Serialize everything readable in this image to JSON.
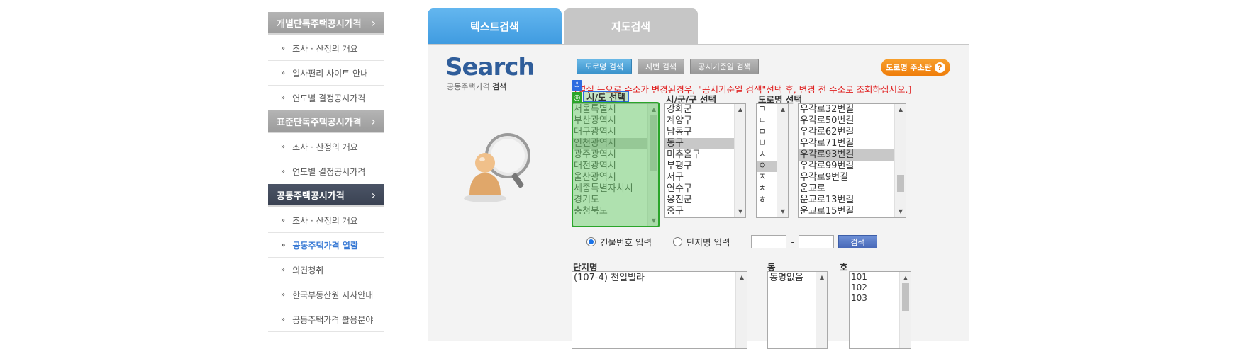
{
  "sidebar": {
    "sections": [
      {
        "title": "개별단독주택공시가격",
        "items": [
          "조사 · 산정의 개요",
          "일사편리 사이트 안내",
          "연도별 결정공시가격"
        ]
      },
      {
        "title": "표준단독주택공시가격",
        "items": [
          "조사 · 산정의 개요",
          "연도별 결정공시가격"
        ]
      },
      {
        "title": "공동주택공시가격",
        "items": [
          "조사 · 산정의 개요",
          "공동주택가격 열람",
          "의견청취",
          "한국부동산원 지사안내",
          "공동주택가격 활용분야"
        ]
      }
    ],
    "chevron": "›",
    "bullet": "»"
  },
  "tabs": {
    "text": "텍스트검색",
    "map": "지도검색"
  },
  "logo": {
    "big": "Search",
    "sub_prefix": "공동주택가격",
    "sub_bold": "검색"
  },
  "buttons": {
    "road": "도로명 검색",
    "lot": "지번 검색",
    "notice": "공시기준일 검색",
    "guide": "도로명 주소란",
    "guide_icon": "?"
  },
  "notice_text": "[멸실 등으로 주소가 변경된경우, \"공시기준일 검색\"선택 후, 변경 전 주소로 조회하십시오.]",
  "labels": {
    "sido": "시/도 선택",
    "sgg": "시/군/구 선택",
    "road": "도로명 선택",
    "complex": "단지명",
    "dong": "동",
    "ho": "호"
  },
  "sido_list": [
    "서울특별시",
    "부산광역시",
    "대구광역시",
    "인천광역시",
    "광주광역시",
    "대전광역시",
    "울산광역시",
    "세종특별자치시",
    "경기도",
    "충청북도"
  ],
  "sido_selected": "인천광역시",
  "sgg_list": [
    "강화군",
    "계양구",
    "남동구",
    "동구",
    "미추홀구",
    "부평구",
    "서구",
    "연수구",
    "옹진군",
    "중구"
  ],
  "sgg_selected": "동구",
  "initial_list": [
    "ㄱ",
    "ㄷ",
    "ㅁ",
    "ㅂ",
    "ㅅ",
    "ㅇ",
    "ㅈ",
    "ㅊ",
    "ㅎ"
  ],
  "initial_selected": "ㅇ",
  "road_list": [
    "우각로32번길",
    "우각로50번길",
    "우각로62번길",
    "우각로71번길",
    "우각로93번길",
    "우각로99번길",
    "우각로9번길",
    "운교로",
    "운교로13번길",
    "운교로15번길"
  ],
  "road_selected": "우각로93번길",
  "search_options": {
    "building_no": "건물번호 입력",
    "complex_name": "단지명 입력",
    "selected": "building_no",
    "dash": "-",
    "search_btn": "검색"
  },
  "complex_list": [
    "(107-4) 천일빌라"
  ],
  "dong_list": [
    "동명없음"
  ],
  "ho_list": [
    "101",
    "102",
    "103"
  ],
  "icons": {
    "anchor": "anchor-icon",
    "target": "target-icon"
  }
}
